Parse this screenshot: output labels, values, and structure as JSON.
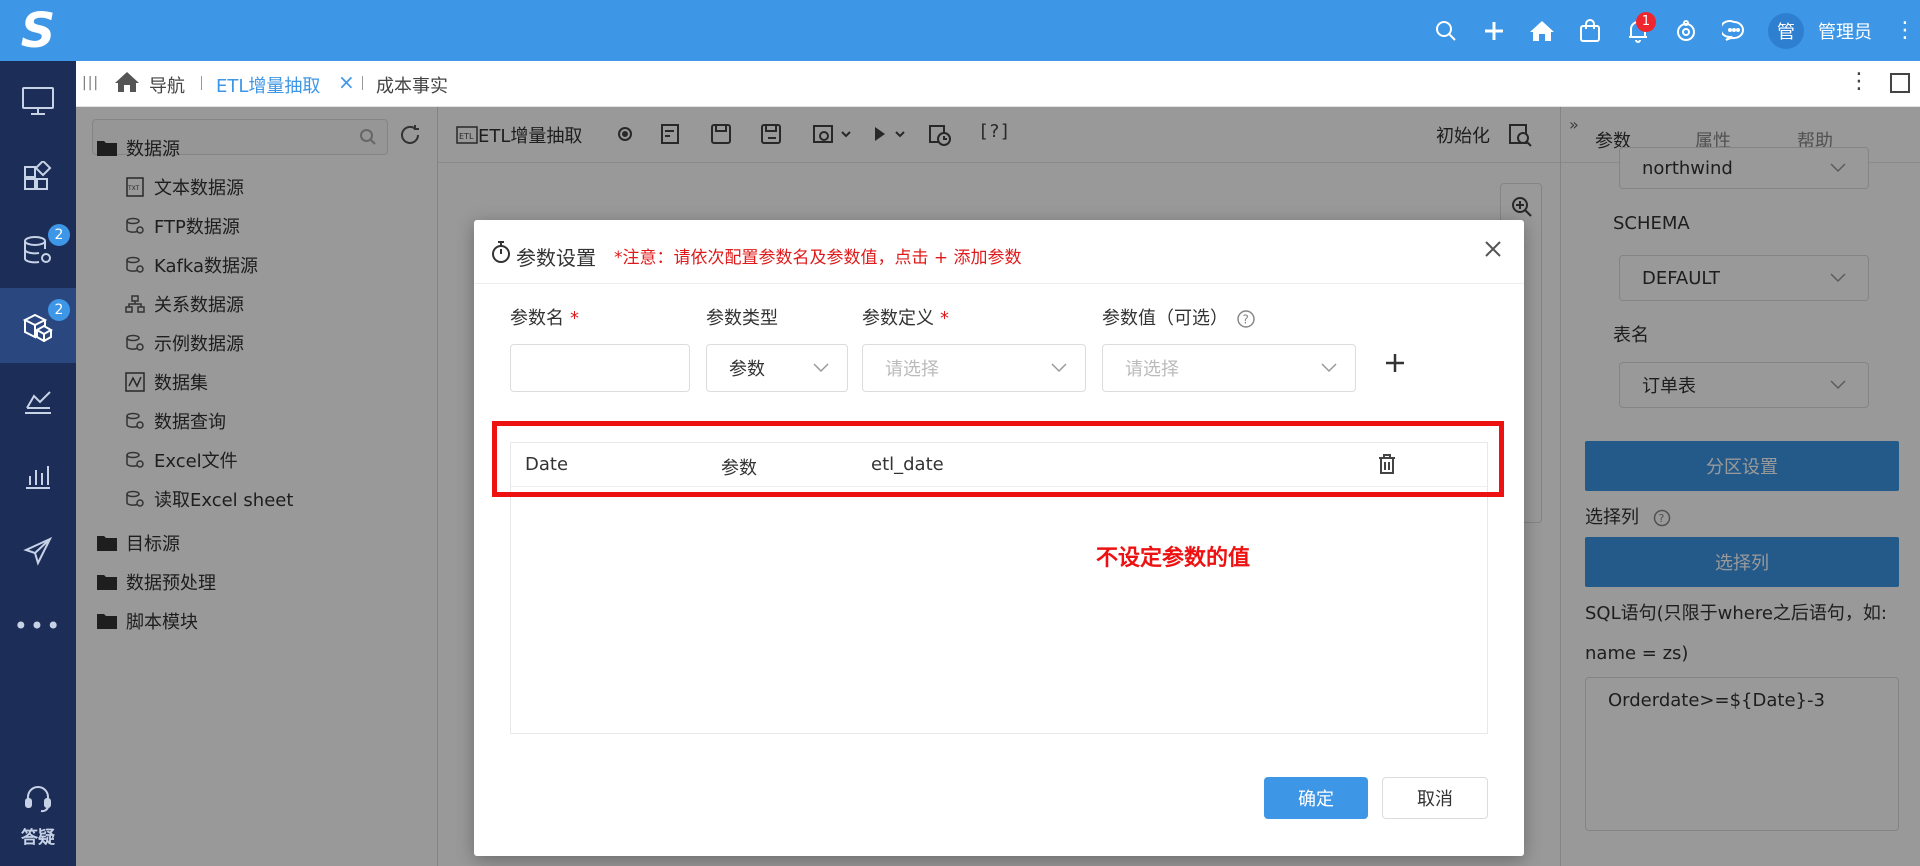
{
  "header": {
    "logo_letter": "S",
    "notification_count": "1",
    "avatar_text": "管",
    "user_name": "管理员"
  },
  "left_nav": {
    "badges": [
      "2",
      "2"
    ],
    "help_label": "答疑"
  },
  "tabs": {
    "nav_label": "导航",
    "etl_label": "ETL增量抽取",
    "cost_label": "成本事实"
  },
  "tree": {
    "items": [
      {
        "label": "数据源",
        "type": "folder"
      },
      {
        "label": "文本数据源",
        "type": "text-file"
      },
      {
        "label": "FTP数据源",
        "type": "db"
      },
      {
        "label": "Kafka数据源",
        "type": "db"
      },
      {
        "label": "关系数据源",
        "type": "relation"
      },
      {
        "label": "示例数据源",
        "type": "db"
      },
      {
        "label": "数据集",
        "type": "dataset"
      },
      {
        "label": "数据查询",
        "type": "db"
      },
      {
        "label": "Excel文件",
        "type": "db"
      },
      {
        "label": "读取Excel sheet",
        "type": "db"
      },
      {
        "label": "目标源",
        "type": "folder"
      },
      {
        "label": "数据预处理",
        "type": "folder"
      },
      {
        "label": "脚本模块",
        "type": "folder"
      }
    ]
  },
  "toolbar": {
    "etl_label": "ETL增量抽取",
    "init_label": "初始化"
  },
  "props": {
    "tabs": [
      "参数",
      "属性",
      "帮助"
    ],
    "database_value": "northwind",
    "schema_label": "SCHEMA",
    "schema_value": "DEFAULT",
    "table_label": "表名",
    "table_value": "订单表",
    "partition_button": "分区设置",
    "select_col_label": "选择列",
    "select_col_button": "选择列",
    "sql_label_1": "SQL语句(只限于where之后语句，如:",
    "sql_label_2": "name = zs)",
    "sql_value": "Orderdate>=${Date}-3"
  },
  "modal": {
    "title": "参数设置",
    "note": "*注意：请依次配置参数名及参数值，点击 + 添加参数",
    "col_name": "参数名",
    "col_type": "参数类型",
    "col_def": "参数定义",
    "col_value": "参数值（可选）",
    "required_mark": "*",
    "type_value": "参数",
    "def_placeholder": "请选择",
    "value_placeholder": "请选择",
    "rows": [
      {
        "name": "Date",
        "type": "参数",
        "definition": "etl_date"
      }
    ],
    "annotation": "不设定参数的值",
    "ok_label": "确定",
    "cancel_label": "取消"
  }
}
